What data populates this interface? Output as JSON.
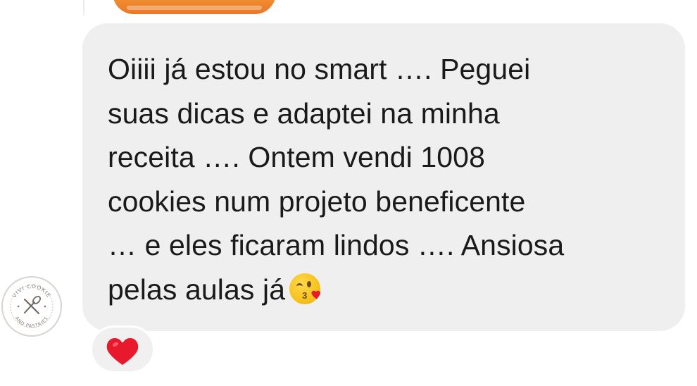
{
  "conversation": {
    "message": {
      "lines": [
        "Oiiii já estou no smart …. Peguei",
        "suas dicas e adaptei na minha",
        "receita …. Ontem vendi 1008",
        "cookies num projeto beneficente",
        "… e eles ficaram lindos …. Ansiosa",
        "pelas aulas já"
      ],
      "trailing_emoji": "face-blowing-a-kiss-icon",
      "bubble_color": "#efefef",
      "text_color": "#1a1a1a"
    },
    "sender_avatar": {
      "logo_text_top": "VIVI COOKIE",
      "logo_text_bottom": "AND PASTRIES",
      "icon": "whisk-and-spoon-logo"
    },
    "reaction": {
      "icon": "red-heart-icon",
      "color": "#e8192c"
    },
    "previous_message_media": {
      "icon": "image-thumbnail",
      "color": "#f08a2e"
    }
  }
}
